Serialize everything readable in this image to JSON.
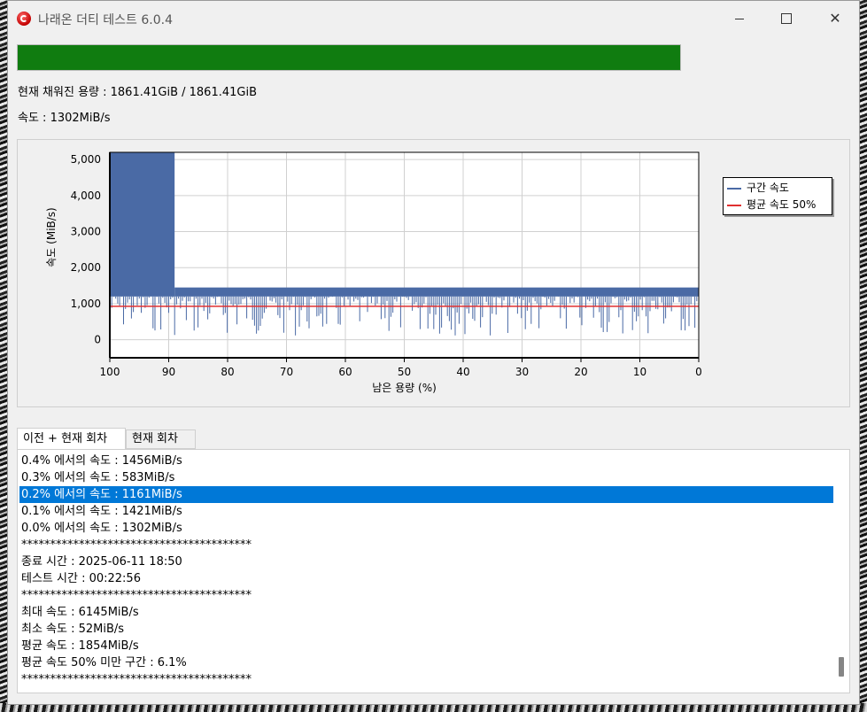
{
  "window": {
    "title": "나래온 더티 테스트 6.0.4"
  },
  "progress": {
    "fraction": 1.0,
    "color": "#107c10"
  },
  "info": {
    "filled": "현재 채워진 용량 : 1861.41GiB / 1861.41GiB",
    "speed": "속도 : 1302MiB/s"
  },
  "chart_data": {
    "type": "line",
    "xlabel": "남은 용량 (%)",
    "ylabel": "속도 (MiB/s)",
    "xlim": [
      100,
      0
    ],
    "ylim": [
      -500,
      5200
    ],
    "xticks": [
      "100",
      "90",
      "80",
      "70",
      "60",
      "50",
      "40",
      "30",
      "20",
      "10",
      "0"
    ],
    "yticks": [
      "5,000",
      "4,000",
      "3,000",
      "2,000",
      "1,000",
      "0"
    ],
    "grid": true,
    "legend_position": "right",
    "series": [
      {
        "name": "구간 속도",
        "color": "#4a6aa5",
        "segments": [
          {
            "x_from": 100,
            "x_to": 89,
            "min": 1200,
            "max": 5200,
            "dips_to": 200
          },
          {
            "x_from": 89,
            "x_to": 0,
            "min": 1200,
            "max": 1450,
            "dips_to": 100
          }
        ]
      },
      {
        "name": "평균 속도 50%",
        "color": "#e03030",
        "value": 927
      }
    ]
  },
  "tabs": [
    {
      "label": "이전 + 현재 회차",
      "active": true
    },
    {
      "label": "현재 회차",
      "active": false
    }
  ],
  "log_lines": [
    "0.4% 에서의 속도 : 1456MiB/s",
    "0.3% 에서의 속도 : 583MiB/s",
    "0.2% 에서의 속도 : 1161MiB/s",
    "0.1% 에서의 속도 : 1421MiB/s",
    "0.0% 에서의 속도 : 1302MiB/s",
    "****************************************",
    "종료 시간 : 2025-06-11 18:50",
    "테스트 시간 : 00:22:56",
    "****************************************",
    "최대 속도 : 6145MiB/s",
    "최소 속도 : 52MiB/s",
    "평균 속도 : 1854MiB/s",
    "평균 속도 50% 미만 구간 : 6.1%",
    "****************************************"
  ],
  "selected_line": 2
}
